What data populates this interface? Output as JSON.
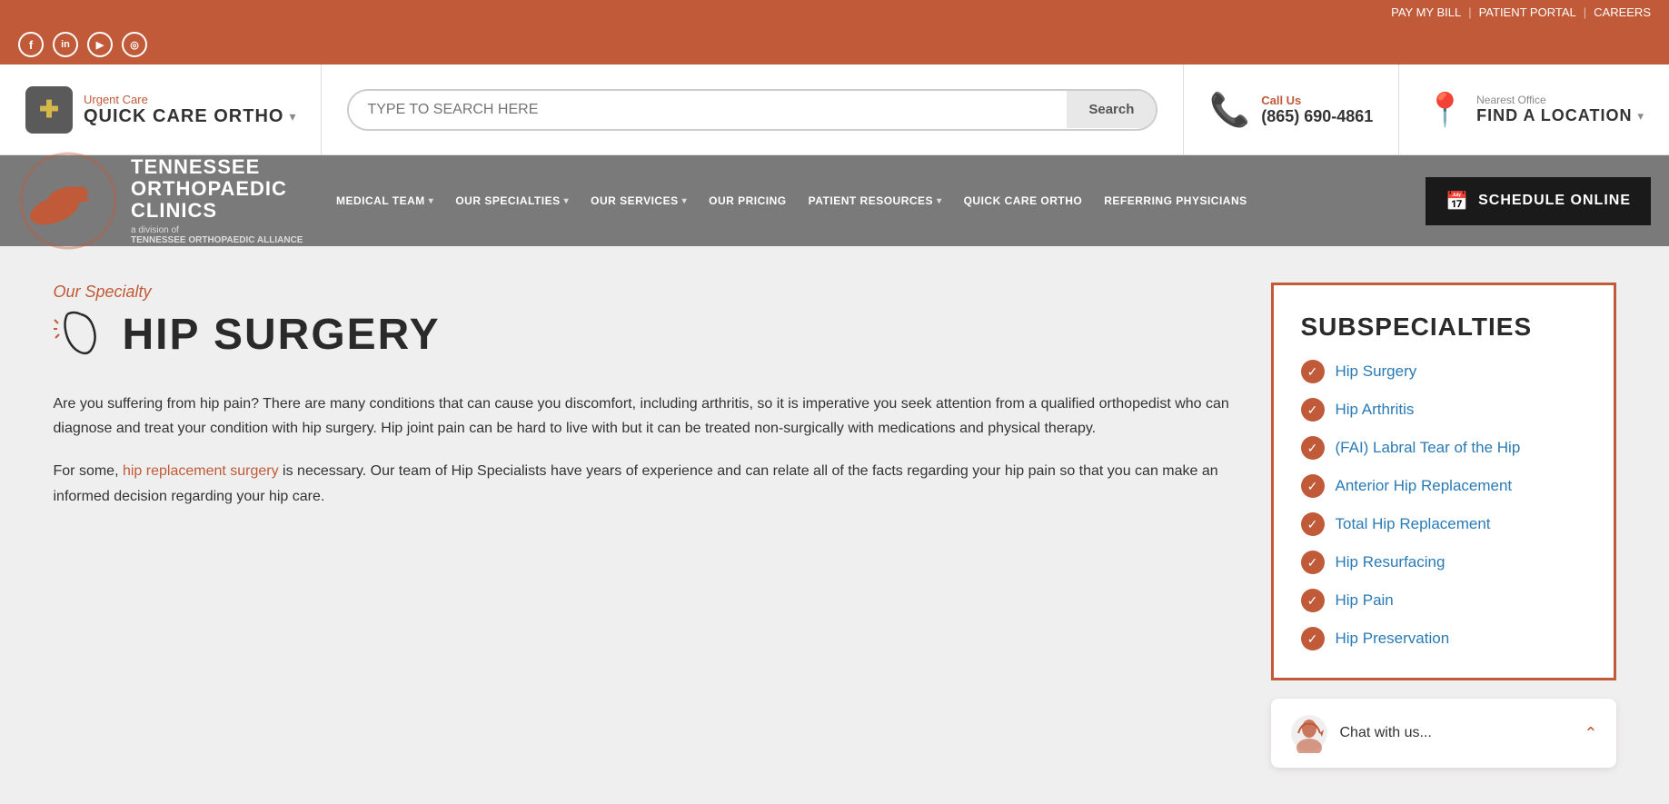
{
  "topbar": {
    "links": [
      {
        "label": "PAY MY BILL",
        "key": "pay-my-bill"
      },
      {
        "label": "PATIENT PORTAL",
        "key": "patient-portal"
      },
      {
        "label": "CAREERS",
        "key": "careers"
      }
    ]
  },
  "social": {
    "icons": [
      {
        "name": "facebook",
        "symbol": "f"
      },
      {
        "name": "linkedin",
        "symbol": "in"
      },
      {
        "name": "youtube",
        "symbol": "▶"
      },
      {
        "name": "instagram",
        "symbol": "◎"
      }
    ]
  },
  "header": {
    "urgent": {
      "label": "Urgent Care",
      "main": "QUICK CARE ORTHO"
    },
    "search": {
      "placeholder": "TYPE TO SEARCH HERE",
      "button": "Search"
    },
    "call": {
      "label": "Call Us",
      "number": "(865) 690-4861"
    },
    "location": {
      "label": "Nearest Office",
      "main": "FIND A LOCATION"
    }
  },
  "nav": {
    "logo": {
      "name": "TENNESSEE\nORTHOPAEDIC\nCLINICS",
      "division": "a division of",
      "alliance": "TENNESSEE ORTHOPAEDIC ALLIANCE"
    },
    "items": [
      {
        "label": "MEDICAL TEAM",
        "hasDropdown": true
      },
      {
        "label": "OUR SPECIALTIES",
        "hasDropdown": true
      },
      {
        "label": "OUR SERVICES",
        "hasDropdown": true
      },
      {
        "label": "OUR PRICING",
        "hasDropdown": false
      },
      {
        "label": "PATIENT RESOURCES",
        "hasDropdown": true
      },
      {
        "label": "QUICK CARE ORTHO",
        "hasDropdown": false
      },
      {
        "label": "REFERRING PHYSICIANS",
        "hasDropdown": false
      }
    ],
    "schedule_btn": "SCHEDULE ONLINE"
  },
  "page": {
    "specialty_label": "Our Specialty",
    "specialty_title": "HIP SURGERY",
    "paragraphs": [
      "Are you suffering from hip pain? There are many conditions that can cause you discomfort, including arthritis, so it is imperative you seek attention from a qualified orthopedist who can diagnose and treat your condition with hip surgery. Hip joint pain can be hard to live with but it can be treated non-surgically with medications and physical therapy.",
      "For some, {link} is necessary. Our team of Hip Specialists have years of experience and can relate all of the facts regarding your hip pain so that you can make an informed decision regarding your hip care."
    ],
    "link_text": "hip replacement surgery",
    "paragraph2_before": "For some, ",
    "paragraph2_after": " is necessary. Our team of Hip Specialists have years of experience and can relate all of the facts regarding your hip pain so that you can make an informed decision regarding your hip care."
  },
  "subspecialties": {
    "title": "SUBSPECIALTIES",
    "items": [
      {
        "label": "Hip Surgery"
      },
      {
        "label": "Hip Arthritis"
      },
      {
        "label": "(FAI) Labral Tear of the Hip"
      },
      {
        "label": "Anterior Hip Replacement"
      },
      {
        "label": "Total Hip Replacement"
      },
      {
        "label": "Hip Resurfacing"
      },
      {
        "label": "Hip Pain"
      },
      {
        "label": "Hip Preservation"
      }
    ]
  },
  "chat": {
    "text": "Chat with us..."
  }
}
